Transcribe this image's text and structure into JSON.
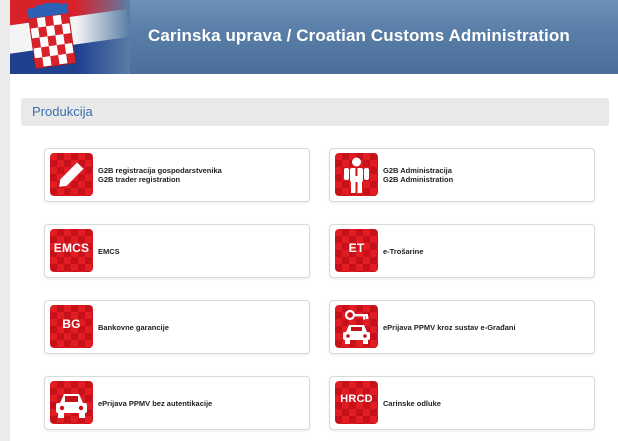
{
  "header": {
    "title": "Carinska uprava / Croatian Customs Administration"
  },
  "section": {
    "title": "Produkcija"
  },
  "tiles": [
    {
      "icon": "pencil-icon",
      "line1": "G2B registracija gospodarstvenika",
      "line2": "G2B trader registration"
    },
    {
      "icon": "person-icon",
      "line1": "G2B Administracija",
      "line2": "G2B Administration"
    },
    {
      "icon": "emcs-icon",
      "code": "EMCS",
      "line1": "EMCS"
    },
    {
      "icon": "et-icon",
      "code": "ET",
      "line1": "e-Trošarine"
    },
    {
      "icon": "bg-icon",
      "code": "BG",
      "line1": "Bankovne garancije"
    },
    {
      "icon": "car-key-icon",
      "line1": "ePrijava PPMV kroz sustav e-Građani"
    },
    {
      "icon": "car-icon",
      "line1": "ePrijava PPMV bez autentikacije"
    },
    {
      "icon": "hrcd-icon",
      "code": "HRCD",
      "line1": "Carinske odluke"
    }
  ],
  "colors": {
    "header": "#587da6",
    "icon_red": "#d4141c",
    "section_title": "#3b6fb0"
  }
}
